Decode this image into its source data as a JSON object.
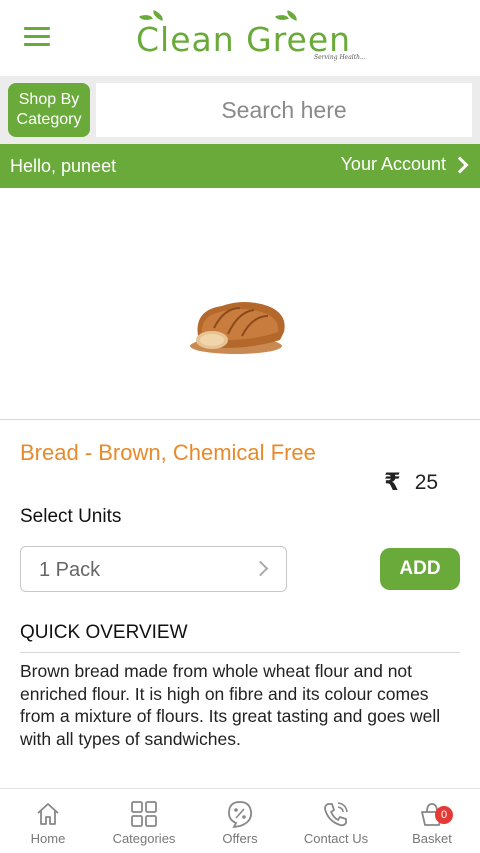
{
  "header": {
    "logo_text": "Clean Green",
    "logo_tagline": "Serving Health..."
  },
  "search": {
    "category_button": "Shop By Category",
    "placeholder": "Search here"
  },
  "greeting": {
    "hello": "Hello, puneet",
    "account": "Your Account"
  },
  "product": {
    "name": "Bread - Brown, Chemical Free",
    "currency_symbol": "₹",
    "price": "25",
    "units_label": "Select Units",
    "selected_unit": "1 Pack",
    "add_button": "ADD",
    "overview_title": "QUICK OVERVIEW",
    "overview_text": "Brown bread made from whole wheat flour and not enriched flour. It is high on fibre and its colour comes from a mixture of flours. Its great tasting and goes well with all types of sandwiches."
  },
  "bottom_nav": {
    "items": [
      {
        "label": "Home",
        "icon": "home-icon"
      },
      {
        "label": "Categories",
        "icon": "grid-icon"
      },
      {
        "label": "Offers",
        "icon": "percent-badge-icon"
      },
      {
        "label": "Contact Us",
        "icon": "phone-icon"
      },
      {
        "label": "Basket",
        "icon": "basket-icon"
      }
    ],
    "basket_count": "0"
  },
  "colors": {
    "brand_green": "#6aaa3a",
    "title_orange": "#e88a2a",
    "badge_red": "#e53935"
  }
}
